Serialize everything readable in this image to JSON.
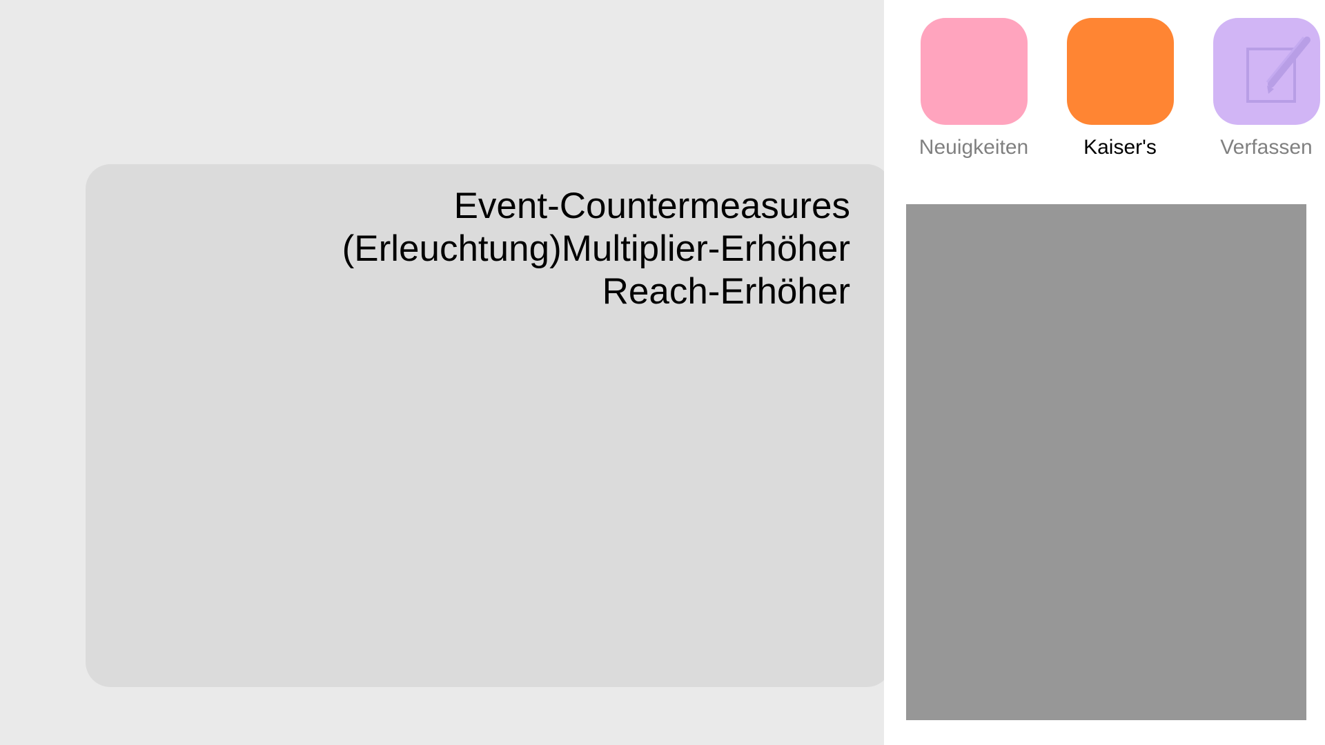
{
  "main_card": {
    "lines": [
      "Event-Countermeasures",
      "(Erleuchtung)Multiplier-Erhöher",
      "Reach-Erhöher"
    ]
  },
  "apps": [
    {
      "label": "Neuigkeiten",
      "color": "#ffa4be",
      "label_color": "#808080",
      "icon": "news-app-icon"
    },
    {
      "label": "Kaiser's",
      "color": "#ff8533",
      "label_color": "#000000",
      "icon": "kaisers-app-icon"
    },
    {
      "label": "Verfassen",
      "color": "#d1b5f5",
      "label_color": "#808080",
      "icon": "compose-icon"
    }
  ]
}
